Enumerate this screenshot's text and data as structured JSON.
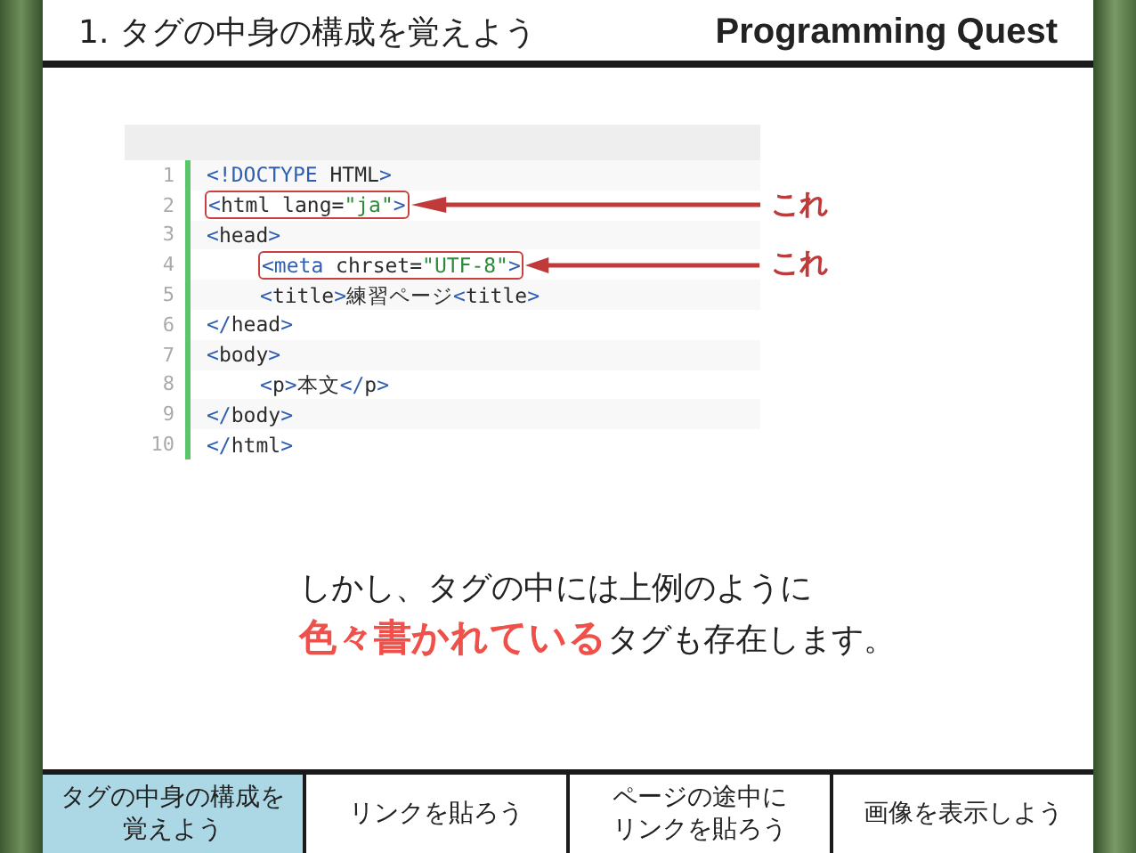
{
  "header": {
    "title": "1. タグの中身の構成を覚えよう",
    "brand": "Programming Quest"
  },
  "code": {
    "lines": [
      {
        "number": "1",
        "highlighted": false,
        "tokens": [
          {
            "kind": "tag",
            "text": "<!DOCTYPE"
          },
          {
            "kind": "text",
            "text": " HTML"
          },
          {
            "kind": "tag",
            "text": ">"
          }
        ]
      },
      {
        "number": "2",
        "highlighted": true,
        "note": "これ",
        "tokens": [
          {
            "kind": "tag",
            "text": "<"
          },
          {
            "kind": "text",
            "text": "html lang="
          },
          {
            "kind": "str",
            "text": "\"ja\""
          },
          {
            "kind": "tag",
            "text": ">"
          }
        ]
      },
      {
        "number": "3",
        "highlighted": false,
        "tokens": [
          {
            "kind": "tag",
            "text": "<"
          },
          {
            "kind": "text",
            "text": "head"
          },
          {
            "kind": "tag",
            "text": ">"
          }
        ],
        "children": [
          {
            "number": "4",
            "highlighted": true,
            "note": "これ",
            "tokens": [
              {
                "kind": "tag",
                "text": "<meta"
              },
              {
                "kind": "text",
                "text": " chrset="
              },
              {
                "kind": "str",
                "text": "\"UTF-8\""
              },
              {
                "kind": "tag",
                "text": ">"
              }
            ]
          },
          {
            "number": "5",
            "highlighted": false,
            "tokens": [
              {
                "kind": "tag",
                "text": "<"
              },
              {
                "kind": "text",
                "text": "title"
              },
              {
                "kind": "tag",
                "text": ">"
              },
              {
                "kind": "text",
                "text": "練習ページ"
              },
              {
                "kind": "tag",
                "text": "<"
              },
              {
                "kind": "text",
                "text": "title"
              },
              {
                "kind": "tag",
                "text": ">"
              }
            ]
          }
        ]
      },
      {
        "number": "6",
        "highlighted": false,
        "tokens": [
          {
            "kind": "tag",
            "text": "</"
          },
          {
            "kind": "text",
            "text": "head"
          },
          {
            "kind": "tag",
            "text": ">"
          }
        ]
      },
      {
        "number": "7",
        "highlighted": false,
        "tokens": [
          {
            "kind": "tag",
            "text": "<"
          },
          {
            "kind": "text",
            "text": "body"
          },
          {
            "kind": "tag",
            "text": ">"
          }
        ],
        "children": [
          {
            "number": "8",
            "highlighted": false,
            "tokens": [
              {
                "kind": "tag",
                "text": "<"
              },
              {
                "kind": "text",
                "text": "p"
              },
              {
                "kind": "tag",
                "text": ">"
              },
              {
                "kind": "text",
                "text": "本文"
              },
              {
                "kind": "tag",
                "text": "</"
              },
              {
                "kind": "text",
                "text": "p"
              },
              {
                "kind": "tag",
                "text": ">"
              }
            ]
          }
        ]
      },
      {
        "number": "9",
        "highlighted": false,
        "tokens": [
          {
            "kind": "tag",
            "text": "</"
          },
          {
            "kind": "text",
            "text": "body"
          },
          {
            "kind": "tag",
            "text": ">"
          }
        ]
      },
      {
        "number": "10",
        "highlighted": false,
        "tokens": [
          {
            "kind": "tag",
            "text": "</"
          },
          {
            "kind": "text",
            "text": "html"
          },
          {
            "kind": "tag",
            "text": ">"
          }
        ]
      }
    ]
  },
  "message": [
    "しかし、タグの中には上例のように",
    "**色々書かれている**タグも存在します。"
  ],
  "tabs": [
    {
      "lines": [
        "タグの中身の構成を",
        "覚えよう"
      ],
      "selected": true
    },
    {
      "lines": [
        "リンクを貼ろう"
      ],
      "selected": false
    },
    {
      "lines": [
        "ページの途中に",
        "リンクを貼ろう"
      ],
      "selected": false
    },
    {
      "lines": [
        "画像を表示しよう"
      ],
      "selected": false
    }
  ]
}
